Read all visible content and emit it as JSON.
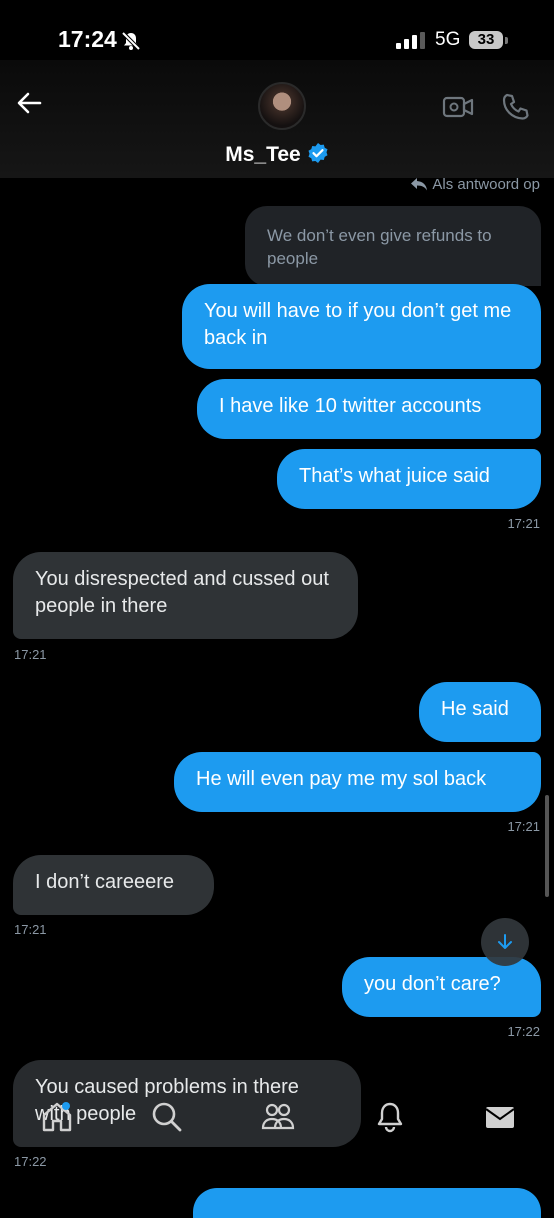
{
  "status_bar": {
    "time": "17:24",
    "network": "5G",
    "battery": "33"
  },
  "header": {
    "contact_name": "Ms_Tee"
  },
  "reply_context": {
    "label": "Als antwoord op",
    "quoted_text": "We don’t even give refunds to people"
  },
  "messages": [
    {
      "text": "You will have to if you don’t get me back in",
      "direction": "out"
    },
    {
      "text": "I have like 10 twitter accounts",
      "direction": "out"
    },
    {
      "text": "That’s what juice said",
      "direction": "out",
      "time": "17:21"
    },
    {
      "text": "You disrespected and cussed out people in there",
      "direction": "in",
      "time": "17:21"
    },
    {
      "text": "He said",
      "direction": "out"
    },
    {
      "text": "He will even pay me my sol back",
      "direction": "out",
      "time": "17:21"
    },
    {
      "text": "I don’t careeere",
      "direction": "in",
      "time": "17:21"
    },
    {
      "text": "you don’t care?",
      "direction": "out",
      "time": "17:22"
    },
    {
      "text": "You caused problems in there with people",
      "direction": "in",
      "time": "17:22"
    }
  ],
  "colors": {
    "accent": "#1d9bf0",
    "incoming_bubble": "#2f3336",
    "background": "#000000"
  },
  "tabbar": {
    "items": [
      "home-icon",
      "search-icon",
      "communities-icon",
      "notifications-icon",
      "messages-icon"
    ]
  }
}
